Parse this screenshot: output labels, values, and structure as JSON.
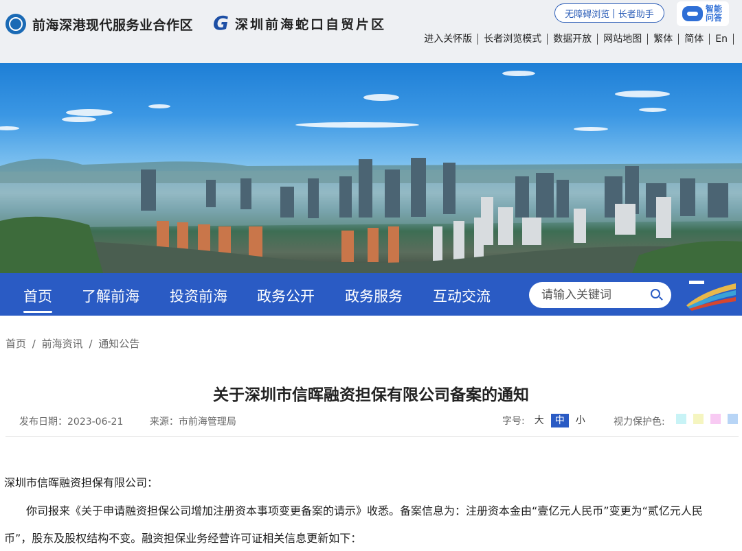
{
  "header": {
    "logo1_text": "前海深港现代服务业合作区",
    "logo2_text": "深圳前海蛇口自贸片区",
    "accessibility": "无障碍浏览",
    "elder_assistant": "长者助手",
    "ai_label": "智能问答",
    "links": [
      "进入关怀版",
      "长者浏览模式",
      "数据开放",
      "网站地图",
      "繁体",
      "简体",
      "En"
    ]
  },
  "nav": {
    "items": [
      "首页",
      "了解前海",
      "投资前海",
      "政务公开",
      "政务服务",
      "互动交流"
    ],
    "search_placeholder": "请输入关键词"
  },
  "breadcrumb": [
    "首页",
    "/",
    "前海资讯",
    "/",
    "通知公告"
  ],
  "article": {
    "title": "关于深圳市信晖融资担保有限公司备案的通知",
    "date_label": "发布日期：",
    "date": "2023-06-21",
    "source_label": "来源：",
    "source": "市前海管理局",
    "font_size_label": "字号:",
    "font_sizes": [
      "大",
      "中",
      "小"
    ],
    "eye_care_label": "视力保护色:",
    "eye_colors": [
      "#c8f3f6",
      "#f5f5c0",
      "#f8caf3",
      "#b8d5f6"
    ],
    "salutation": "深圳市信晖融资担保有限公司：",
    "body_line1": "你司报来《关于申请融资担保公司增加注册资本事项变更备案的请示》收悉。备案信息为：注册资本金由“壹亿元人民币”变更为“贰亿元人民",
    "body_line2": "币”，股东及股权结构不变。融资担保业务经营许可证相关信息更新如下："
  },
  "colors": {
    "nav_bg": "#2a5bc4",
    "brand_blue": "#2e5fb8"
  }
}
